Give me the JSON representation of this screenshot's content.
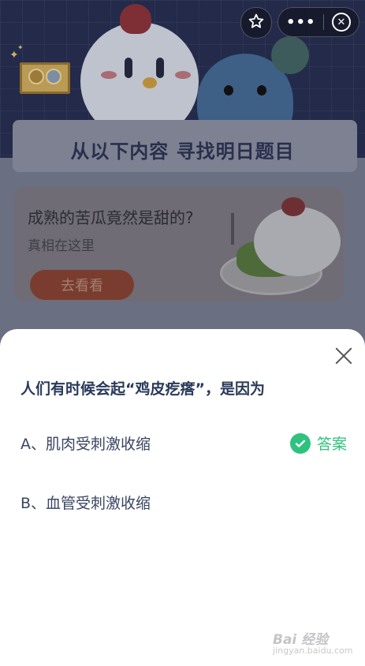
{
  "header": {
    "favorite_icon": "star-icon",
    "more_icon": "more-dots-icon",
    "close_icon": "close-circle-icon"
  },
  "board": {
    "title": "从以下内容 寻找明日题目"
  },
  "promo": {
    "headline": "成熟的苦瓜竟然是甜的?",
    "subtitle": "真相在这里",
    "button_label": "去看看"
  },
  "sheet": {
    "question": "人们有时候会起“鸡皮疙瘩”，是因为",
    "options": [
      {
        "label": "A、肌肉受刺激收缩",
        "is_answer": true
      },
      {
        "label": "B、血管受刺激收缩",
        "is_answer": false
      }
    ],
    "answer_label": "答案",
    "colors": {
      "answer": "#2ec27e",
      "question": "#2a3a5a"
    }
  },
  "watermark": {
    "brand": "Bai 经验",
    "domain": "jingyan.baidu.com"
  }
}
